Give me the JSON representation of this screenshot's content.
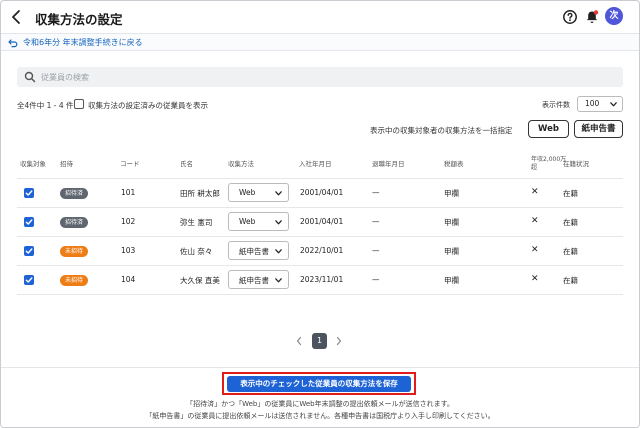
{
  "header": {
    "title": "収集方法の設定",
    "avatar_text": "次"
  },
  "breadcrumb": {
    "back_link": "令和6年分 年末調整手続きに戻る"
  },
  "search": {
    "placeholder": "従業員の検索",
    "value": ""
  },
  "list_controls": {
    "count_text": "全4件中 1 - 4 件",
    "filter_label": "収集方法の設定済みの従業員を表示",
    "filter_checked": false,
    "per_page_label": "表示件数",
    "per_page_value": "100"
  },
  "bulk": {
    "label": "表示中の収集対象者の収集方法を一括指定",
    "web_button": "Web",
    "paper_button": "紙申告書"
  },
  "table": {
    "columns": [
      "収集対象",
      "招待",
      "コード",
      "氏名",
      "収集方法",
      "入社年月日",
      "退職年月日",
      "税額表",
      "年収2,000万超",
      "在籍状況"
    ],
    "rows": [
      {
        "selected": true,
        "invite": "招待済",
        "invite_state": "invited",
        "code": "101",
        "name": "田所 耕太郎",
        "method": "Web",
        "hire_date": "2001/04/01",
        "retire_date": "—",
        "tax_table": "甲欄",
        "over_20m": "✕",
        "status": "在籍"
      },
      {
        "selected": true,
        "invite": "招待済",
        "invite_state": "invited",
        "code": "102",
        "name": "弥生 憲司",
        "method": "Web",
        "hire_date": "2001/04/01",
        "retire_date": "—",
        "tax_table": "甲欄",
        "over_20m": "✕",
        "status": "在籍"
      },
      {
        "selected": true,
        "invite": "未招待",
        "invite_state": "uninvited",
        "code": "103",
        "name": "佐山 奈々",
        "method": "紙申告書",
        "hire_date": "2022/10/01",
        "retire_date": "—",
        "tax_table": "甲欄",
        "over_20m": "✕",
        "status": "在籍"
      },
      {
        "selected": true,
        "invite": "未招待",
        "invite_state": "uninvited",
        "code": "104",
        "name": "大久保 直美",
        "method": "紙申告書",
        "hire_date": "2023/11/01",
        "retire_date": "—",
        "tax_table": "甲欄",
        "over_20m": "✕",
        "status": "在籍"
      }
    ]
  },
  "pagination": {
    "current_page": "1"
  },
  "footer": {
    "save_button": "表示中のチェックした従業員の収集方法を保存",
    "note1": "「招待済」かつ「Web」の従業員にWeb年末調整の提出依頼メールが送信されます。",
    "note2": "「紙申告書」の従業員に提出依頼メールは送信されません。各種申告書は国税庁より入手し印刷してください。"
  },
  "colors": {
    "primary": "#1e63d6",
    "invited_badge": "#5f6670",
    "uninvited_badge": "#ee7d16",
    "avatar": "#4f56d9",
    "highlight_outline": "#e21b1b"
  },
  "icons": [
    "back-chevron-icon",
    "help-icon",
    "bell-icon",
    "undo-arrow-icon",
    "search-icon",
    "chevron-down-icon",
    "close-icon",
    "chevron-left-icon",
    "chevron-right-icon"
  ]
}
